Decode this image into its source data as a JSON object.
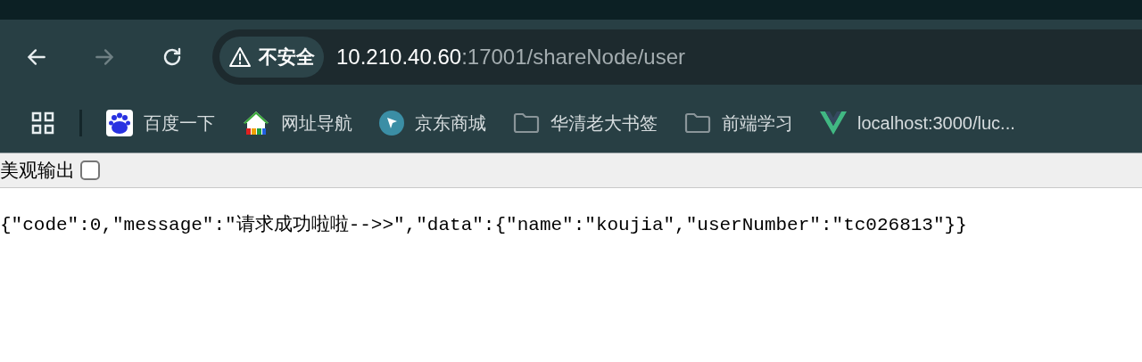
{
  "toolbar": {
    "back_disabled": false,
    "forward_disabled": true
  },
  "address_bar": {
    "security_label": "不安全",
    "host": "10.210.40.60",
    "path": ":17001/shareNode/user"
  },
  "bookmarks": [
    {
      "kind": "baidu",
      "label": "百度一下"
    },
    {
      "kind": "site2345",
      "label": "网址导航"
    },
    {
      "kind": "jd",
      "label": "京东商城"
    },
    {
      "kind": "folder",
      "label": "华清老大书签"
    },
    {
      "kind": "folder",
      "label": "前端学习"
    },
    {
      "kind": "vue",
      "label": "localhost:3000/luc..."
    }
  ],
  "pretty_print": {
    "label": "美观输出",
    "checked": false
  },
  "body_text": "{\"code\":0,\"message\":\"请求成功啦啦-->>\",\"data\":{\"name\":\"koujia\",\"userNumber\":\"tc026813\"}}"
}
